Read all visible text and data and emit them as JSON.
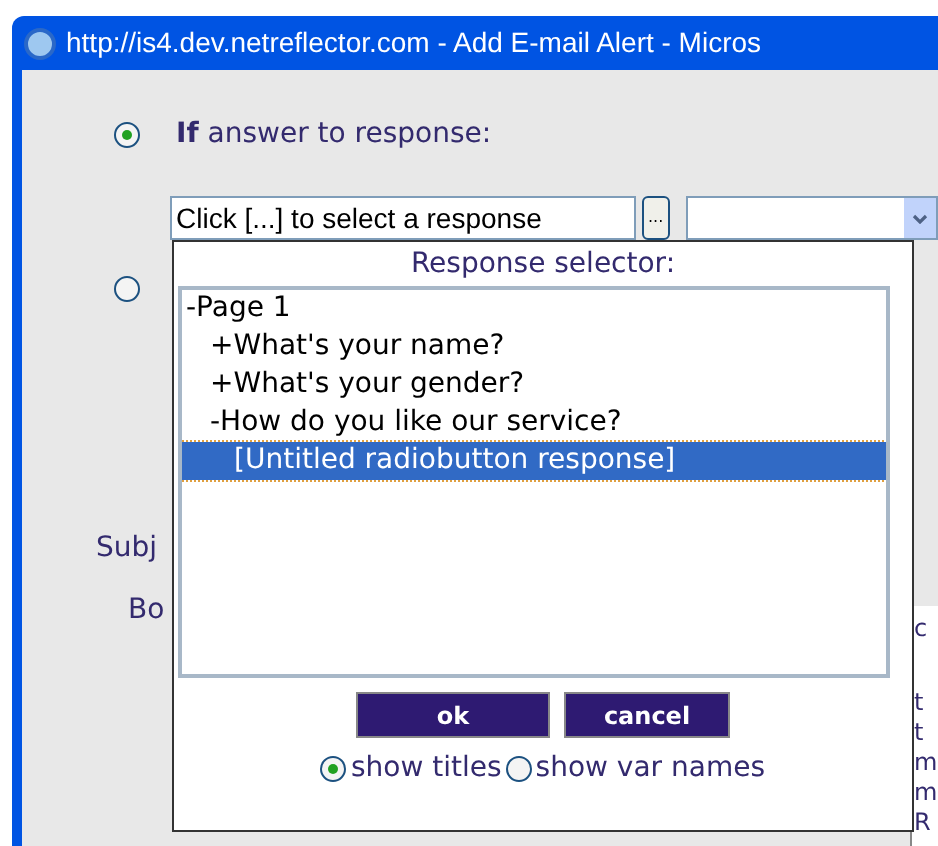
{
  "window": {
    "title": "http://is4.dev.netreflector.com - Add E-mail Alert - Micros"
  },
  "condition_options": [
    {
      "label": "**If** answer to response:",
      "selected": true
    },
    {
      "selected": false
    }
  ],
  "response_field": {
    "value": "Click [...] to select a response",
    "browse_button": "..."
  },
  "form_labels": [
    "Subj",
    "Bo"
  ],
  "right_fragments": [
    "c",
    "t",
    "t",
    "m",
    "m",
    "R"
  ],
  "popup": {
    "title": "Response selector:",
    "tree": [
      {
        "label": "-Page 1",
        "selected": false,
        "children": [
          {
            "label": "+What's your name?",
            "selected": false
          },
          {
            "label": "+What's your gender?",
            "selected": false
          },
          {
            "label": "-How do you like our service?",
            "selected": false,
            "children": [
              {
                "label": "[Untitled radiobutton response]",
                "selected": true
              }
            ]
          }
        ]
      }
    ],
    "buttons": [
      "ok",
      "cancel"
    ],
    "display_options": [
      {
        "label": "show titles",
        "selected": true
      },
      {
        "label": "show var names",
        "selected": false
      }
    ]
  }
}
